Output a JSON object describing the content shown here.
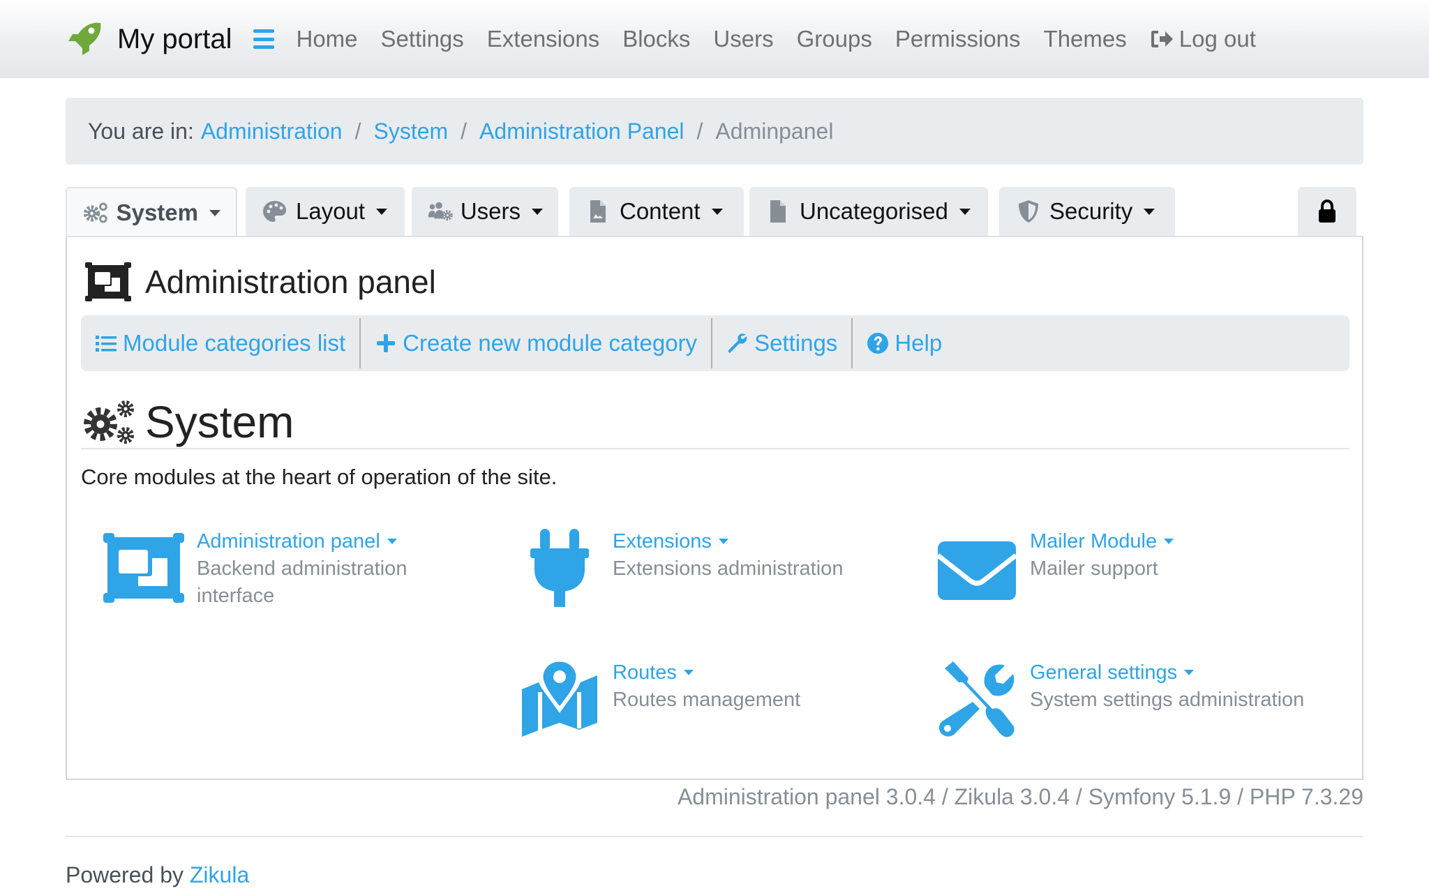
{
  "navbar": {
    "brand": "My portal",
    "brand_color": "#6fa83b",
    "accent_color": "#2fa4e7",
    "links": [
      {
        "label": "Home"
      },
      {
        "label": "Settings"
      },
      {
        "label": "Extensions"
      },
      {
        "label": "Blocks"
      },
      {
        "label": "Users"
      },
      {
        "label": "Groups"
      },
      {
        "label": "Permissions"
      },
      {
        "label": "Themes"
      },
      {
        "label": "Log out",
        "icon": "sign-out-icon"
      }
    ]
  },
  "breadcrumb": {
    "prefix": "You are in:",
    "items": [
      {
        "label": "Administration",
        "link": true
      },
      {
        "label": "System",
        "link": true
      },
      {
        "label": "Administration Panel",
        "link": true
      },
      {
        "label": "Adminpanel",
        "link": false
      }
    ],
    "separator": "/"
  },
  "tabs": [
    {
      "label": "System",
      "icon": "cogs-icon",
      "active": true
    },
    {
      "label": "Layout",
      "icon": "palette-icon",
      "active": false
    },
    {
      "label": "Users",
      "icon": "users-cog-icon",
      "active": false
    },
    {
      "label": "Content",
      "icon": "file-image-icon",
      "active": false
    },
    {
      "label": "Uncategorised",
      "icon": "file-icon",
      "active": false
    },
    {
      "label": "Security",
      "icon": "shield-icon",
      "active": false
    }
  ],
  "lock_tab": {
    "icon": "lock-icon"
  },
  "panel": {
    "title": "Administration panel",
    "actions": [
      {
        "label": "Module categories list",
        "icon": "list-icon"
      },
      {
        "label": "Create new module category",
        "icon": "plus-icon"
      },
      {
        "label": "Settings",
        "icon": "wrench-icon"
      },
      {
        "label": "Help",
        "icon": "question-circle-icon"
      }
    ],
    "section": {
      "title": "System",
      "description": "Core modules at the heart of operation of the site."
    },
    "modules": [
      {
        "name": "Administration panel",
        "description": "Backend administration interface",
        "icon": "admin-panel-icon"
      },
      {
        "name": "Extensions",
        "description": "Extensions administration",
        "icon": "plug-icon"
      },
      {
        "name": "Mailer Module",
        "description": "Mailer support",
        "icon": "envelope-icon"
      },
      {
        "name": "Routes",
        "description": "Routes management",
        "icon": "map-marked-icon"
      },
      {
        "name": "General settings",
        "description": "System settings administration",
        "icon": "tools-icon"
      }
    ]
  },
  "version_info": "Administration panel 3.0.4 / Zikula 3.0.4 / Symfony 5.1.9 / PHP 7.3.29",
  "footer": {
    "prefix": "Powered by",
    "link": "Zikula"
  }
}
